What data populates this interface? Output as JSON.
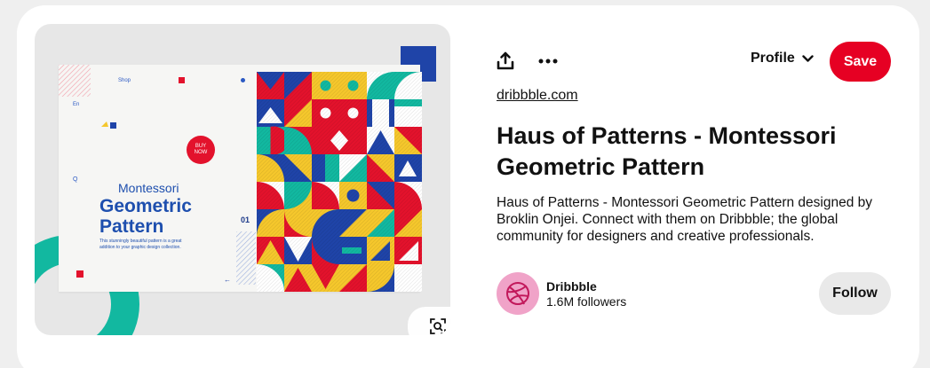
{
  "image": {
    "mock": {
      "shop": "Shop",
      "en": "En",
      "q": "Q",
      "page_number": "01",
      "buy_now_line1": "BUY",
      "buy_now_line2": "NOW",
      "subtitle": "Montessori",
      "title_line1": "Geometric",
      "title_line2": "Pattern",
      "description": "This stunningly beautiful pattern is a great addition to your graphic design collection."
    },
    "lens_icon": "visual-search-icon"
  },
  "actions": {
    "share_icon": "share-icon",
    "more_icon": "more-icon",
    "profile_label": "Profile",
    "save_label": "Save"
  },
  "pin": {
    "source": "dribbble.com",
    "title": "Haus of Patterns - Montessori Geometric Pattern",
    "description": "Haus of Patterns - Montessori Geometric Pattern designed by Broklin Onjei. Connect with them on Dribbble; the global community for designers and creative professionals."
  },
  "creator": {
    "name": "Dribbble",
    "followers": "1.6M followers",
    "follow_label": "Follow",
    "avatar_icon": "dribbble-logo-icon"
  },
  "colors": {
    "save": "#e60023",
    "pattern_red": "#e3122c",
    "pattern_blue": "#1f44a8",
    "pattern_yellow": "#f5c72c",
    "pattern_teal": "#12b8a0",
    "avatar_bg": "#f0a3c8"
  }
}
